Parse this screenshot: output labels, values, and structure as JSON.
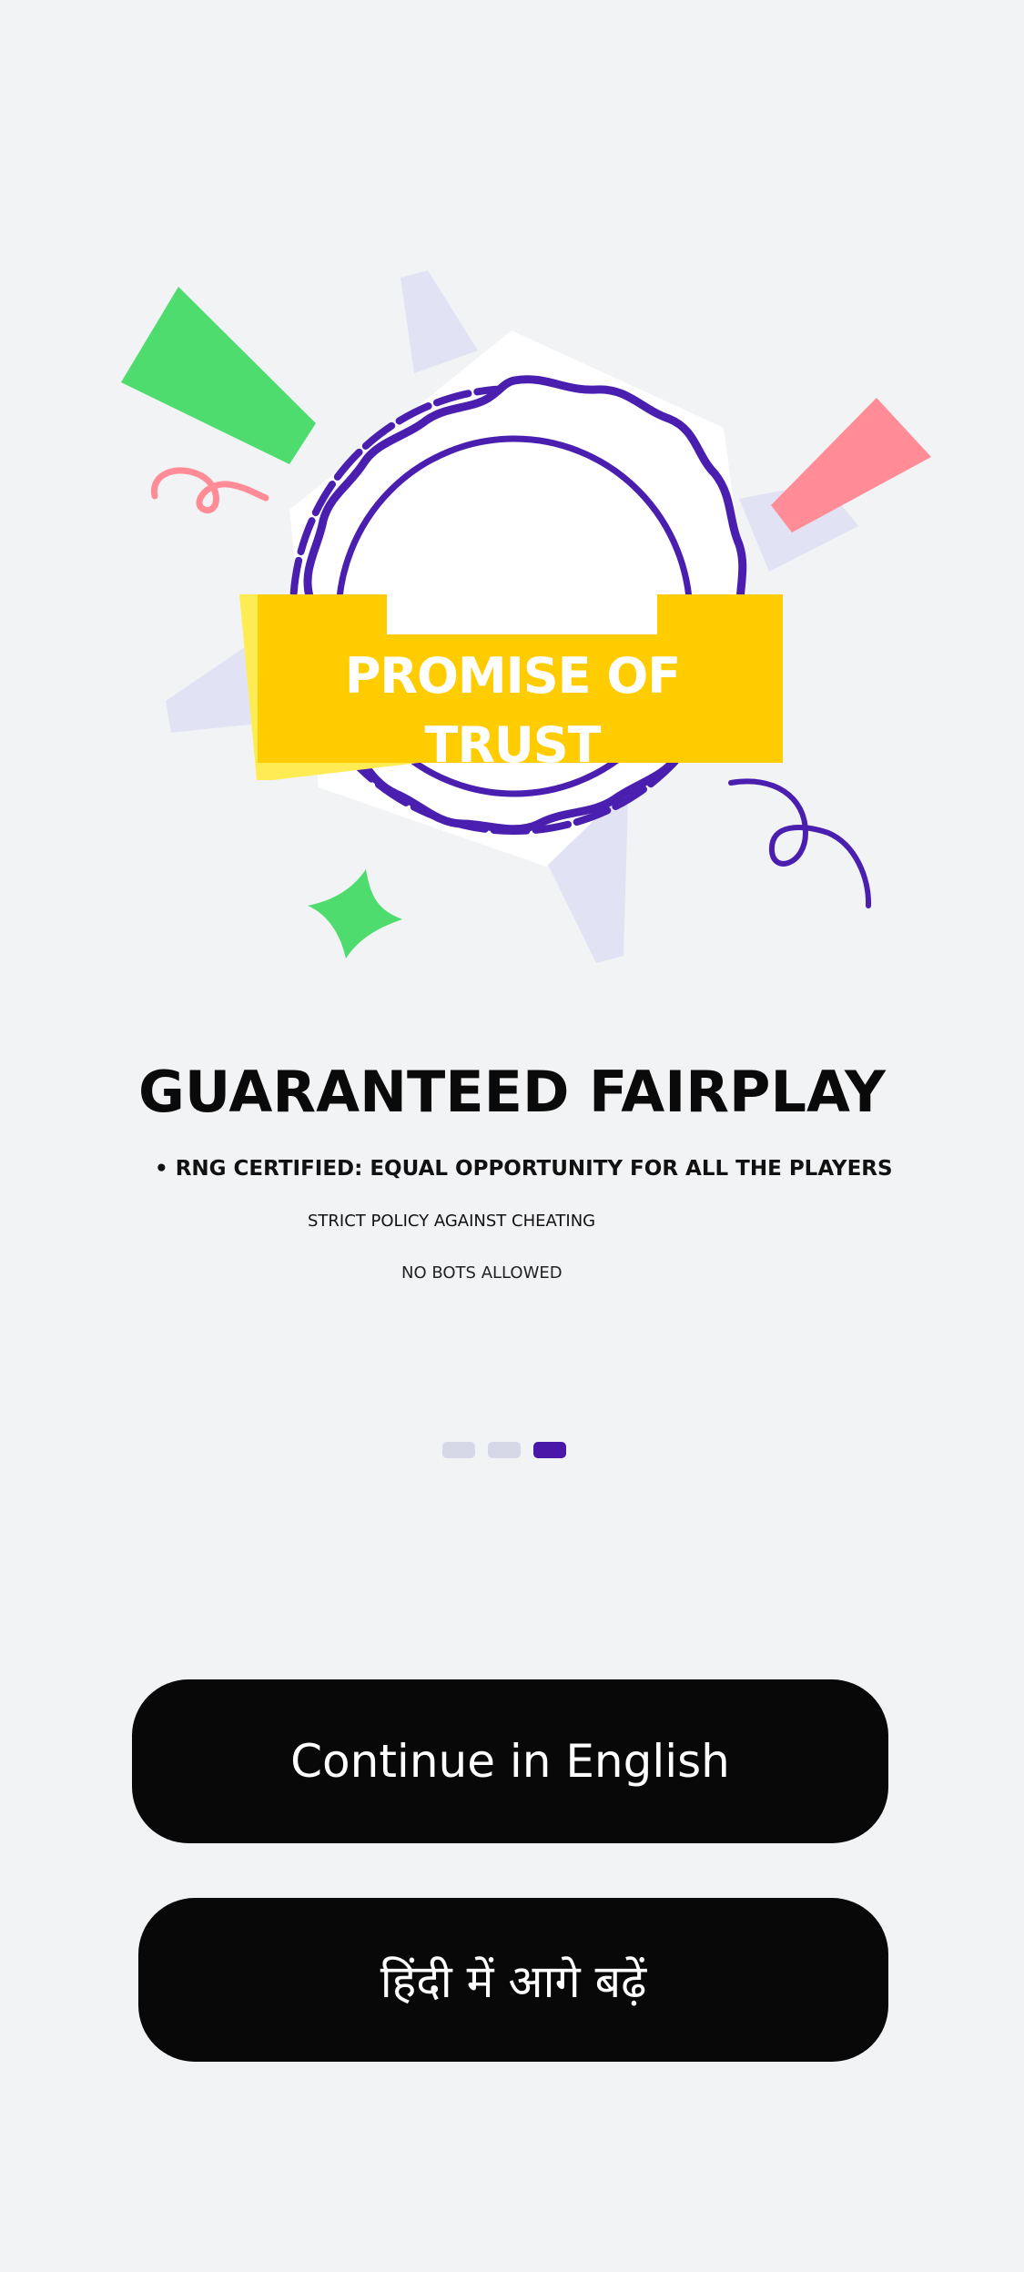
{
  "hero": {
    "badge_label": "PROMISE OF TRUST",
    "colors": {
      "badge_yellow": "#ffcc00",
      "accent_purple": "#4a1fb0",
      "green": "#4fdc6e",
      "pink": "#ff8c96",
      "lavender": "#e1e3f5"
    }
  },
  "content": {
    "headline": "GUARANTEED FAIRPLAY",
    "bullets": [
      "• RNG CERTIFIED: EQUAL OPPORTUNITY FOR ALL THE PLAYERS",
      "STRICT POLICY AGAINST CHEATING",
      "NO BOTS ALLOWED"
    ]
  },
  "pagination": {
    "total_pages": 3,
    "active_page": 3,
    "active_color": "#4a18a8",
    "inactive_color": "#d6d8e8"
  },
  "actions": {
    "english_label": "Continue in English",
    "hindi_label": "हिंदी में आगे बढ़ें"
  }
}
